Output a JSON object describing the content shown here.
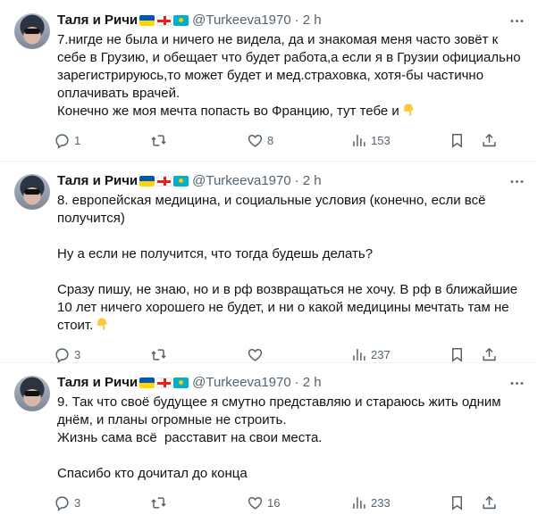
{
  "tweets": [
    {
      "name": "Таля и Ричи",
      "handle": "@Turkeeva1970",
      "dot": "·",
      "time": "2 h",
      "text": "7.нигде не была и ничего не видела, да и знакомая меня часто зовёт к себе в Грузию, и обещает что будет работа,а если я в Грузии официально зарегистрируюсь,то может будет и мед.страховка, хотя-бы частично оплачивать врачей.\nКонечно же моя мечта попасть во Францию, тут тебе и",
      "emoji": "pointing-down-emoji",
      "replies": "1",
      "retweets": "",
      "likes": "8",
      "views": "153"
    },
    {
      "name": "Таля и Ричи",
      "handle": "@Turkeeva1970",
      "dot": "·",
      "time": "2 h",
      "text": "8. европейская медицина, и социальные условия (конечно, если всё получится)\n\nНу а если не получится, что тогда будешь делать?\n\nСразу пишу, не знаю, но и в рф возвращаться не хочу. В рф в ближайшие 10 лет ничего хорошего не будет, и ни о какой медицины мечтать там не стоит.",
      "emoji": "pointing-down-emoji",
      "replies": "3",
      "retweets": "",
      "likes": "",
      "views": "237"
    },
    {
      "name": "Таля и Ричи",
      "handle": "@Turkeeva1970",
      "dot": "·",
      "time": "2 h",
      "text": "9. Так что своё будущее я смутно представляю и стараюсь жить одним днём, и планы огромные не строить.\nЖизнь сама всё  расставит на свои места.\n\nСпасибо кто дочитал до конца",
      "emoji": "",
      "replies": "3",
      "retweets": "",
      "likes": "16",
      "views": "233"
    }
  ],
  "colors": {
    "text": "#0f1419",
    "secondary": "#536471",
    "divider": "#eff3f4",
    "emoji": "#ffc83d"
  }
}
